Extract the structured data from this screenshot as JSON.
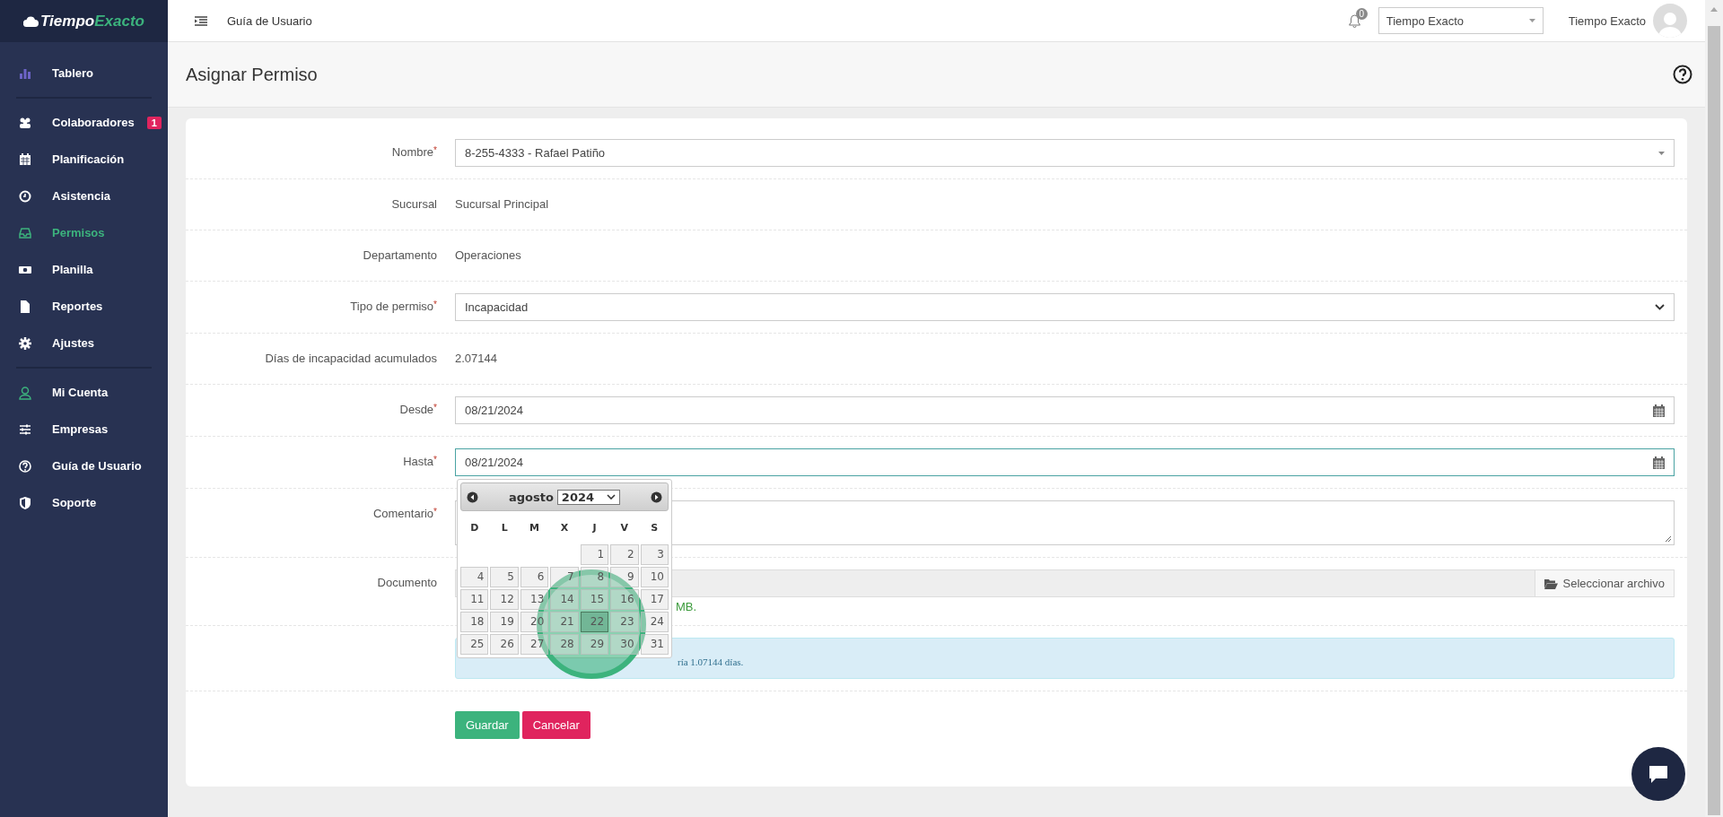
{
  "brand": {
    "first": "Tiempo",
    "second": "Exacto"
  },
  "sidebar": {
    "groups": [
      [
        {
          "label": "Tablero",
          "selected": false
        }
      ],
      [
        {
          "label": "Colaboradores",
          "selected": false,
          "badge": "1"
        },
        {
          "label": "Planificación",
          "selected": false
        },
        {
          "label": "Asistencia",
          "selected": false
        },
        {
          "label": "Permisos",
          "selected": true
        },
        {
          "label": "Planilla",
          "selected": false
        },
        {
          "label": "Reportes",
          "selected": false
        },
        {
          "label": "Ajustes",
          "selected": false
        }
      ],
      [
        {
          "label": "Mi Cuenta",
          "selected": false
        },
        {
          "label": "Empresas",
          "selected": false
        },
        {
          "label": "Guía de Usuario",
          "selected": false
        },
        {
          "label": "Soporte",
          "selected": false
        }
      ]
    ]
  },
  "header": {
    "breadcrumb": "Guía de Usuario",
    "notifications": "0",
    "company": "Tiempo Exacto",
    "user": "Tiempo Exacto"
  },
  "page_title": "Asignar Permiso",
  "form": {
    "rows": [
      {
        "kind": "select",
        "label": "Nombre",
        "mark": "*",
        "value": "8-255-4333 - Rafael Patiño"
      },
      {
        "kind": "text",
        "label": "Sucursal",
        "value": "Sucursal Principal"
      },
      {
        "kind": "text",
        "label": "Departamento",
        "value": "Operaciones"
      },
      {
        "kind": "dropdown",
        "label": "Tipo de permiso",
        "mark": "*",
        "value": "Incapacidad"
      },
      {
        "kind": "text",
        "label": "Días de incapacidad acumulados",
        "value": "2.07144"
      },
      {
        "kind": "date",
        "label": "Desde",
        "mark": "*",
        "value": "08/21/2024"
      },
      {
        "kind": "date",
        "label": "Hasta",
        "mark": "*",
        "value": "08/21/2024",
        "focused": true
      },
      {
        "kind": "textarea",
        "label": "Comentario",
        "mark": "*"
      },
      {
        "kind": "file",
        "label": "Documento",
        "button": "Seleccionar archivo",
        "hint": "MB."
      },
      {
        "kind": "info",
        "text": "ría 1.07144 días."
      }
    ],
    "buttons": [
      {
        "kind": "primary",
        "label": "Guardar"
      },
      {
        "kind": "danger",
        "label": "Cancelar"
      }
    ]
  },
  "datepicker": {
    "month": "agosto",
    "year": "2024",
    "weekdays": [
      "D",
      "L",
      "M",
      "X",
      "J",
      "V",
      "S"
    ],
    "weeks": [
      [
        {
          "day": "1",
          "selected": false
        },
        {
          "day": "2",
          "selected": false
        },
        {
          "day": "3",
          "selected": false
        }
      ],
      [
        {
          "day": "4",
          "selected": false
        },
        {
          "day": "5",
          "selected": false
        },
        {
          "day": "6",
          "selected": false
        },
        {
          "day": "7",
          "selected": false
        },
        {
          "day": "8",
          "selected": false
        },
        {
          "day": "9",
          "selected": false
        },
        {
          "day": "10",
          "selected": false
        }
      ],
      [
        {
          "day": "11",
          "selected": false
        },
        {
          "day": "12",
          "selected": false
        },
        {
          "day": "13",
          "selected": false
        },
        {
          "day": "14",
          "selected": false
        },
        {
          "day": "15",
          "selected": false
        },
        {
          "day": "16",
          "selected": false
        },
        {
          "day": "17",
          "selected": false
        }
      ],
      [
        {
          "day": "18",
          "selected": false
        },
        {
          "day": "19",
          "selected": false
        },
        {
          "day": "20",
          "selected": false
        },
        {
          "day": "21",
          "selected": false
        },
        {
          "day": "22",
          "selected": true
        },
        {
          "day": "23",
          "selected": false
        },
        {
          "day": "24",
          "selected": false
        }
      ],
      [
        {
          "day": "25",
          "selected": false
        },
        {
          "day": "26",
          "selected": false
        },
        {
          "day": "27",
          "selected": false
        },
        {
          "day": "28",
          "selected": false
        },
        {
          "day": "29",
          "selected": false
        },
        {
          "day": "30",
          "selected": false
        },
        {
          "day": "31",
          "selected": false
        }
      ]
    ]
  }
}
